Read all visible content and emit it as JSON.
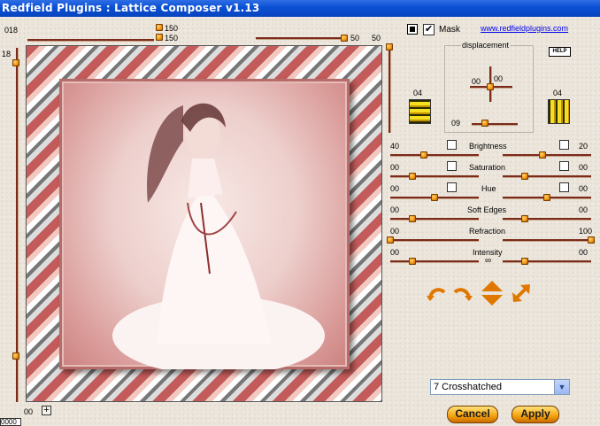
{
  "window": {
    "title": "Redfield Plugins : Lattice Composer v1.13"
  },
  "top_values": {
    "v018": "018",
    "v150a": "150",
    "v150b": "150",
    "v50a": "50",
    "v50b": "50",
    "v18": "18"
  },
  "bottom": {
    "v00": "00",
    "corner": "0000"
  },
  "mask": {
    "label": "Mask",
    "checked": true
  },
  "link": "www.redfieldplugins.com",
  "help": "HELP",
  "displacement": {
    "label": "displacement",
    "x": "00",
    "y": "00",
    "v09": "09",
    "left_count": "04",
    "right_count": "04"
  },
  "sliders": [
    {
      "id": "brightness",
      "label": "Brightness",
      "left": "40",
      "right": "20"
    },
    {
      "id": "saturation",
      "label": "Saturation",
      "left": "00",
      "right": "00"
    },
    {
      "id": "hue",
      "label": "Hue",
      "left": "00",
      "right": "00"
    },
    {
      "id": "soft-edges",
      "label": "Soft Edges",
      "left": "00",
      "right": "00"
    },
    {
      "id": "refraction",
      "label": "Refraction",
      "left": "00",
      "right": "100"
    },
    {
      "id": "intensity",
      "label": "Intensity",
      "left": "00",
      "right": "00"
    }
  ],
  "preset": {
    "selected": "7 Crosshatched"
  },
  "buttons": {
    "cancel": "Cancel",
    "apply": "Apply"
  },
  "icons": [
    "rotate-left-icon",
    "rotate-right-icon",
    "flip-vertical-icon",
    "resize-arrow-icon"
  ],
  "colors": {
    "titlebar": "#0a4fd3",
    "knob": "#f09a10",
    "track": "#7a2b1a",
    "link": "#0000ee"
  }
}
